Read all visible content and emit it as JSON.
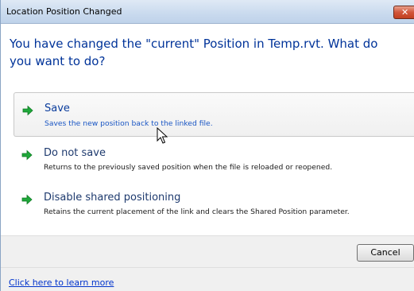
{
  "window": {
    "title": "Location Position Changed"
  },
  "instruction": "You have changed the \"current\" Position in Temp.rvt.  What do you want to do?",
  "options": [
    {
      "title": "Save",
      "description": "Saves the new position back to the linked file.",
      "icon": "green-arrow-icon",
      "state": "hover"
    },
    {
      "title": "Do not save",
      "description": "Returns to the previously saved position when the file is reloaded or reopened.",
      "icon": "green-arrow-icon"
    },
    {
      "title": "Disable shared positioning",
      "description": "Retains the current placement of the link and clears the Shared Position parameter.",
      "icon": "green-arrow-icon"
    }
  ],
  "buttons": {
    "cancel": "Cancel"
  },
  "footer": {
    "link": "Click here to learn more"
  },
  "colors": {
    "instruction_text": "#003399",
    "arrow": "#1fa83a",
    "link": "#0033cc"
  }
}
